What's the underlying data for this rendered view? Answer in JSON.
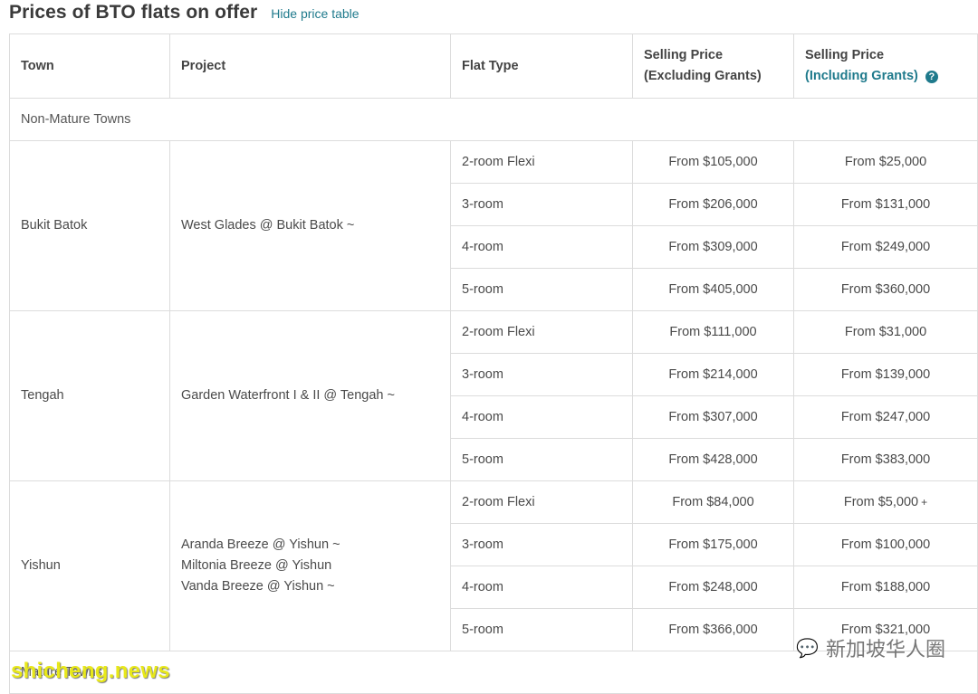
{
  "header": {
    "title": "Prices of BTO flats on offer",
    "hide_link": "Hide price table"
  },
  "table": {
    "columns": {
      "town": "Town",
      "project": "Project",
      "flat_type": "Flat Type",
      "excl_line1": "Selling Price",
      "excl_line2": "(Excluding Grants)",
      "incl_line1": "Selling Price",
      "incl_line2": "(Including Grants)"
    },
    "sections": [
      {
        "label": "Non-Mature Towns",
        "towns": [
          {
            "town": "Bukit Batok",
            "projects": [
              "West Glades @ Bukit Batok ~"
            ],
            "rows": [
              {
                "type": "2-room Flexi",
                "excl": "From $105,000",
                "incl": "From $25,000"
              },
              {
                "type": "3-room",
                "excl": "From $206,000",
                "incl": "From $131,000"
              },
              {
                "type": "4-room",
                "excl": "From $309,000",
                "incl": "From $249,000"
              },
              {
                "type": "5-room",
                "excl": "From $405,000",
                "incl": "From $360,000"
              }
            ]
          },
          {
            "town": "Tengah",
            "projects": [
              "Garden Waterfront I & II @ Tengah ~"
            ],
            "rows": [
              {
                "type": "2-room Flexi",
                "excl": "From $111,000",
                "incl": "From $31,000"
              },
              {
                "type": "3-room",
                "excl": "From $214,000",
                "incl": "From $139,000"
              },
              {
                "type": "4-room",
                "excl": "From $307,000",
                "incl": "From $247,000"
              },
              {
                "type": "5-room",
                "excl": "From $428,000",
                "incl": "From $383,000"
              }
            ]
          },
          {
            "town": "Yishun",
            "projects": [
              "Aranda Breeze @ Yishun ~",
              "Miltonia Breeze @ Yishun",
              "Vanda Breeze @ Yishun ~"
            ],
            "rows": [
              {
                "type": "2-room Flexi",
                "excl": "From $84,000",
                "incl": "From $5,000",
                "incl_mark": "+"
              },
              {
                "type": "3-room",
                "excl": "From $175,000",
                "incl": "From $100,000"
              },
              {
                "type": "4-room",
                "excl": "From $248,000",
                "incl": "From $188,000"
              },
              {
                "type": "5-room",
                "excl": "From $366,000",
                "incl": "From $321,000"
              }
            ]
          }
        ]
      },
      {
        "label": "Mature Towns",
        "towns": []
      }
    ]
  },
  "watermarks": {
    "left": "shicheng.news",
    "right": "新加坡华人圈"
  }
}
